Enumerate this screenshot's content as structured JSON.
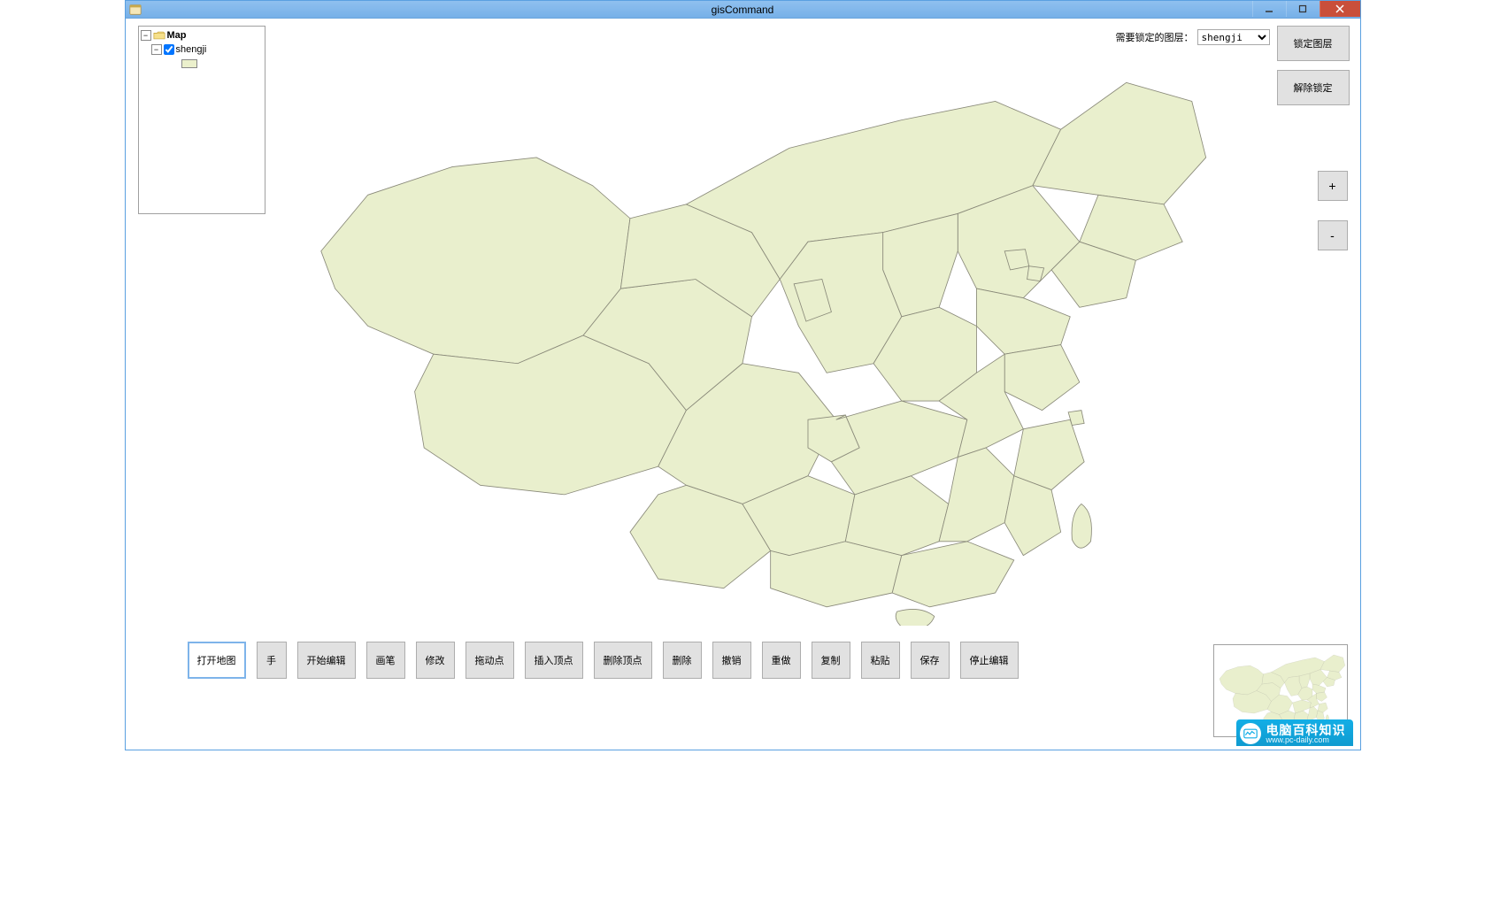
{
  "window": {
    "title": "gisCommand"
  },
  "layer_panel": {
    "root_label": "Map",
    "layers": [
      {
        "name": "shengji",
        "checked": true,
        "swatch": "#ebf0cc"
      }
    ]
  },
  "lock_controls": {
    "label": "需要锁定的图层：",
    "selected": "shengji",
    "options": [
      "shengji"
    ],
    "lock_btn": "锁定图层",
    "unlock_btn": "解除锁定"
  },
  "zoom": {
    "in": "+",
    "out": "-"
  },
  "toolbar": {
    "open_map": "打开地图",
    "hand": "手",
    "start_edit": "开始编辑",
    "brush": "画笔",
    "modify": "修改",
    "drag_point": "拖动点",
    "insert_vertex": "插入顶点",
    "delete_vertex": "删除顶点",
    "delete": "删除",
    "undo": "撤销",
    "redo": "重做",
    "copy": "复制",
    "paste": "粘贴",
    "save": "保存",
    "stop_edit": "停止编辑",
    "selected_key": "open_map"
  },
  "watermark": {
    "top": "电脑百科知识",
    "bottom": "www.pc-daily.com"
  },
  "map": {
    "layer": "shengji",
    "fill": "#e9efcd",
    "stroke": "#8a8a7a"
  }
}
